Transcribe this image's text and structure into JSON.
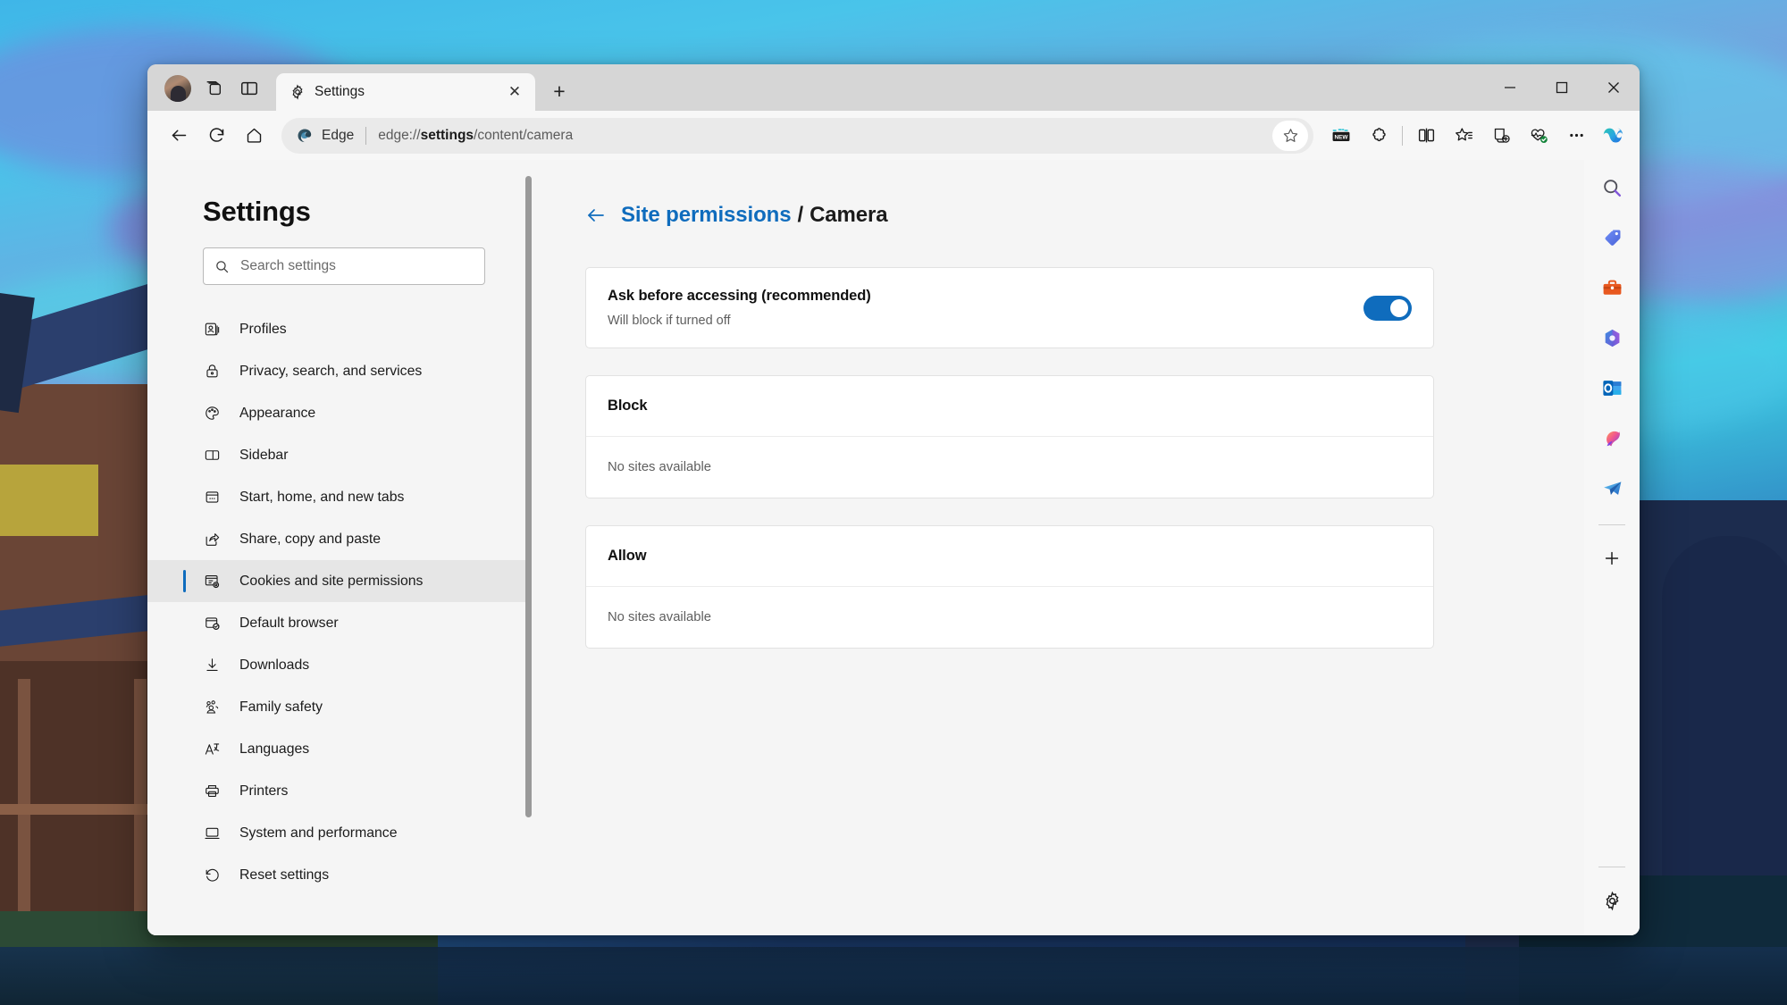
{
  "window": {
    "controls": {
      "minimize": "–",
      "maximize": "□",
      "close": "✕"
    }
  },
  "tabstrip": {
    "avatar_name": "profile-avatar",
    "tab_search_icon": "tab-groups-icon",
    "vertical_tabs_icon": "vertical-tabs-icon",
    "tab": {
      "title": "Settings",
      "icon": "gear-icon",
      "close_label": "✕"
    },
    "new_tab_label": "+"
  },
  "toolbar": {
    "back_icon": "back-arrow-icon",
    "refresh_icon": "refresh-icon",
    "home_icon": "home-icon",
    "edge_label": "Edge",
    "url_prefix": "edge://",
    "url_bold": "settings",
    "url_suffix": "/content/camera",
    "url_full": "edge://settings/content/camera",
    "favorite_icon": "star-outline-icon",
    "actions": [
      {
        "name": "new-badge-icon",
        "label": "NEW"
      },
      {
        "name": "extensions-icon",
        "label": ""
      },
      {
        "name": "split-screen-icon",
        "label": ""
      },
      {
        "name": "favorites-icon",
        "label": ""
      },
      {
        "name": "collections-icon",
        "label": ""
      },
      {
        "name": "browser-essentials-icon",
        "label": ""
      },
      {
        "name": "more-options-icon",
        "label": "…"
      }
    ],
    "copilot_icon": "copilot-icon"
  },
  "settings": {
    "title": "Settings",
    "search": {
      "placeholder": "Search settings",
      "icon": "search-icon"
    },
    "nav": [
      {
        "label": "Profiles",
        "icon": "profiles-icon",
        "selected": false
      },
      {
        "label": "Privacy, search, and services",
        "icon": "lock-icon",
        "selected": false
      },
      {
        "label": "Appearance",
        "icon": "palette-icon",
        "selected": false
      },
      {
        "label": "Sidebar",
        "icon": "sidebar-icon",
        "selected": false
      },
      {
        "label": "Start, home, and new tabs",
        "icon": "start-home-icon",
        "selected": false
      },
      {
        "label": "Share, copy and paste",
        "icon": "share-icon",
        "selected": false
      },
      {
        "label": "Cookies and site permissions",
        "icon": "cookies-icon",
        "selected": true
      },
      {
        "label": "Default browser",
        "icon": "default-browser-icon",
        "selected": false
      },
      {
        "label": "Downloads",
        "icon": "download-icon",
        "selected": false
      },
      {
        "label": "Family safety",
        "icon": "family-icon",
        "selected": false
      },
      {
        "label": "Languages",
        "icon": "languages-icon",
        "selected": false
      },
      {
        "label": "Printers",
        "icon": "printer-icon",
        "selected": false
      },
      {
        "label": "System and performance",
        "icon": "system-icon",
        "selected": false
      },
      {
        "label": "Reset settings",
        "icon": "reset-icon",
        "selected": false
      }
    ]
  },
  "main": {
    "breadcrumb": {
      "back_icon": "back-arrow-icon",
      "parent": "Site permissions",
      "separator": "/",
      "current": "Camera"
    },
    "ask_card": {
      "title": "Ask before accessing (recommended)",
      "subtitle": "Will block if turned off",
      "toggle_state": "on"
    },
    "block_card": {
      "header": "Block",
      "empty": "No sites available"
    },
    "allow_card": {
      "header": "Allow",
      "empty": "No sites available"
    }
  },
  "edgebar": {
    "icons": [
      {
        "name": "search-icon"
      },
      {
        "name": "shopping-tag-icon"
      },
      {
        "name": "tools-icon"
      },
      {
        "name": "microsoft-365-icon"
      },
      {
        "name": "outlook-icon"
      },
      {
        "name": "designer-icon"
      },
      {
        "name": "send-icon"
      }
    ],
    "add_label": "+",
    "settings_icon": "gear-icon"
  },
  "colors": {
    "accent": "#0f6cbd",
    "link": "#0f6cbd",
    "toggle_on": "#0f6cbd",
    "selected_nav_bg": "#e6e6e6",
    "card_bg": "#ffffff",
    "page_bg": "#f5f5f5"
  }
}
